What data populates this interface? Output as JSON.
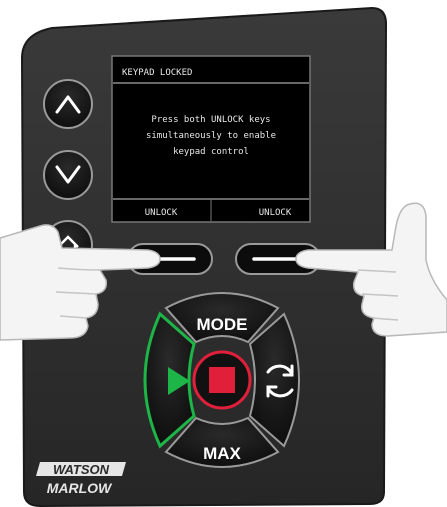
{
  "screen": {
    "header": "KEYPAD LOCKED",
    "message_lines": [
      "Press both UNLOCK keys",
      "simultaneously to enable",
      "keypad control"
    ],
    "softkey_left": "UNLOCK",
    "softkey_right": "UNLOCK"
  },
  "controls": {
    "mode_label": "MODE",
    "max_label": "MAX"
  },
  "brand": {
    "line1": "WATSON",
    "line2": "MARLOW"
  },
  "colors": {
    "panel": "#2a2a2a",
    "screen": "#000000",
    "run_green": "#1db548",
    "stop_red": "#e0203a",
    "button_dark": "#141414"
  },
  "icons": [
    "up-arrow-icon",
    "down-arrow-icon",
    "home-icon",
    "play-icon",
    "stop-icon",
    "refresh-icon"
  ]
}
